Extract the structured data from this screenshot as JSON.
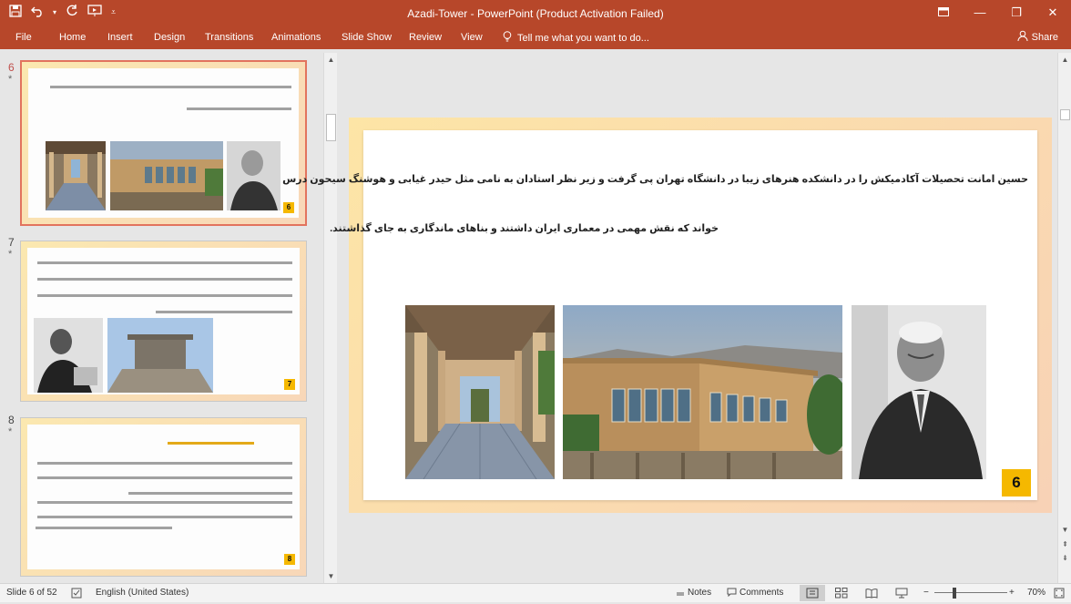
{
  "window": {
    "title": "Azadi-Tower - PowerPoint (Product Activation Failed)",
    "qat_icons": [
      "save-icon",
      "undo-icon",
      "redo-icon",
      "present-icon",
      "more-icon"
    ],
    "controls": [
      "ribbon-options-icon",
      "minimize-icon",
      "restore-icon",
      "close-icon"
    ]
  },
  "ribbon": {
    "tabs": [
      "File",
      "Home",
      "Insert",
      "Design",
      "Transitions",
      "Animations",
      "Slide Show",
      "Review",
      "View"
    ],
    "tell_me": "Tell me what you want to do...",
    "share": "Share"
  },
  "thumbnails": [
    {
      "number": "6",
      "star": "*",
      "badge": "6",
      "selected": true
    },
    {
      "number": "7",
      "star": "*",
      "badge": "7",
      "selected": false
    },
    {
      "number": "8",
      "star": "*",
      "badge": "8",
      "selected": false
    }
  ],
  "slide": {
    "line1": "حسین امانت تحصیلات آکادمیکش را در دانشکده هنرهای زیبا در دانشگاه تهران پی گرفت و زیر نظر استادان به نامی مثل حیدر غیابی و هوشنگ سیحون درس",
    "line2": "خواند که نقش مهمی در معماری ایران داشتند و بناهای ماندگاری به جای گذاشتند.",
    "number": "6",
    "images": [
      "corridor-photo",
      "building-photo",
      "portrait-photo"
    ]
  },
  "status": {
    "slide_info": "Slide 6 of 52",
    "language": "English (United States)",
    "notes": "Notes",
    "comments": "Comments",
    "zoom": "70%"
  },
  "colors": {
    "accent": "#b7472a",
    "badge": "#f5b800"
  }
}
